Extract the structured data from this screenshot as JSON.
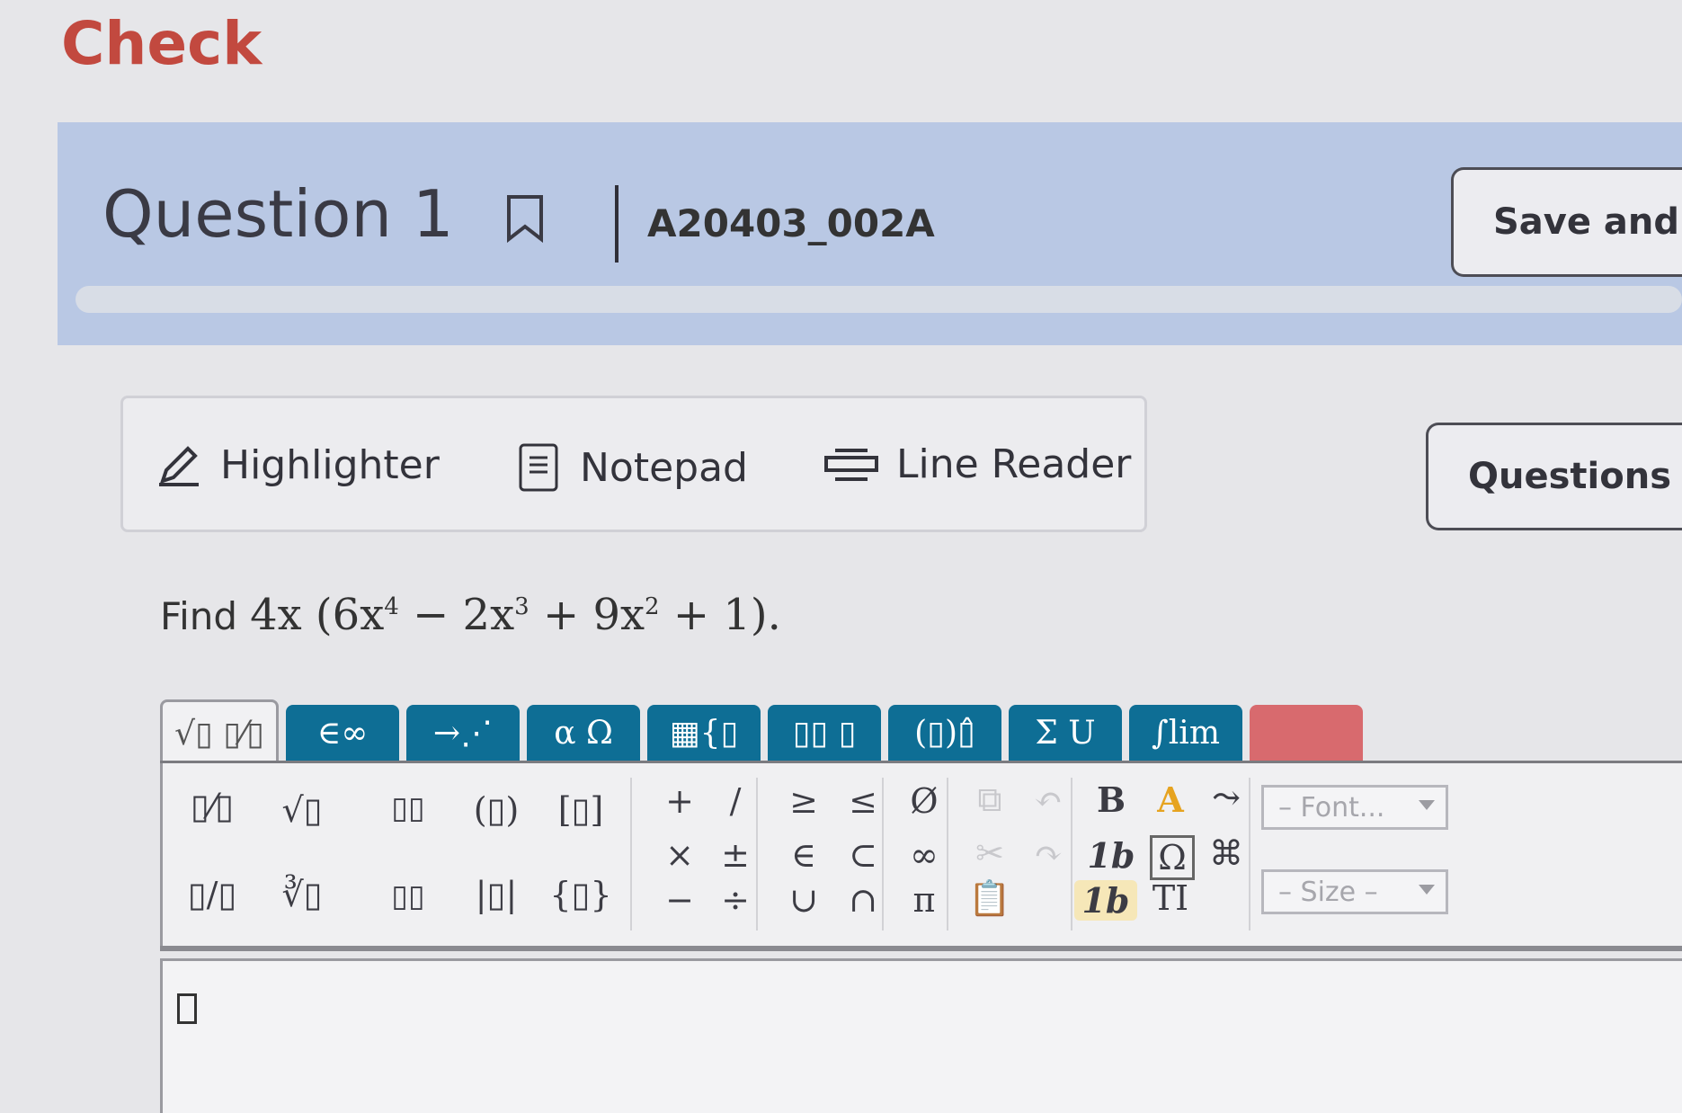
{
  "page_title": "Check",
  "question": {
    "title": "Question 1",
    "code": "A20403_002A",
    "save_label": "Save and E",
    "questions_label": "Questions l"
  },
  "tools": {
    "highlighter": "Highlighter",
    "notepad": "Notepad",
    "line_reader": "Line Reader"
  },
  "prompt": {
    "lead": "Find",
    "expr_a": "4x (6x",
    "exp1": "4",
    "expr_b": " − 2x",
    "exp2": "3",
    "expr_c": " + 9x",
    "exp3": "2",
    "expr_d": " + 1)."
  },
  "editor": {
    "tabs": [
      "√▯ ▯⁄▯",
      "∈∞",
      "→⋰",
      "α Ω",
      "▦{▯",
      "▯▯ ▯",
      "(▯)▯̂",
      "Σ U",
      "∫lim",
      ""
    ],
    "row1": [
      "▯⁄▯",
      "√▯",
      "▯▯",
      "(▯)",
      "[▯]",
      "+",
      "/",
      "≥",
      "≤",
      "Ø",
      "B"
    ],
    "row2": [
      "×",
      "±",
      "∈",
      "⊂",
      "∞",
      "1b",
      "Ω"
    ],
    "row3": [
      "▯/▯",
      "∛▯",
      "▯▯",
      "|▯|",
      "{▯}",
      "−",
      "÷",
      "∪",
      "∩",
      "π",
      "1b",
      "TI"
    ],
    "font_placeholder": "– Font...",
    "size_placeholder": "– Size –"
  },
  "colors": {
    "title_red": "#c2493f",
    "banner_blue": "#b9c8e4",
    "tab_teal": "#0e6e95"
  }
}
